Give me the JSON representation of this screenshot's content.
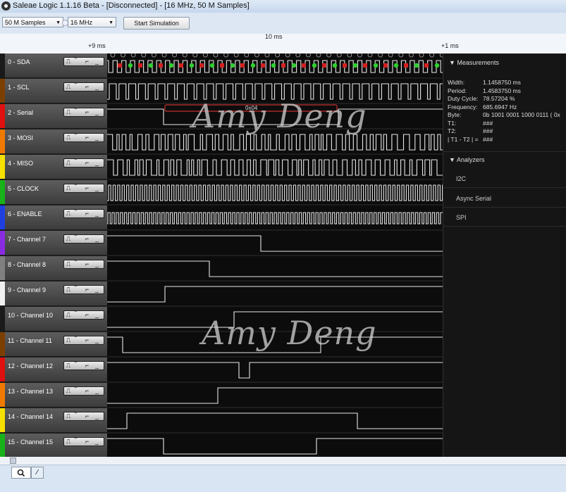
{
  "window": {
    "title": "Saleae Logic 1.1.16 Beta - [Disconnected] - [16 MHz, 50 M Samples]"
  },
  "toolbar": {
    "samples": "50 M Samples",
    "rate": "16 MHz",
    "start_simulation": "Start Simulation"
  },
  "ruler": {
    "left": "+9 ms",
    "center": "10 ms",
    "right": "+1 ms"
  },
  "channels": [
    {
      "name": "0 - SDA",
      "color": "#1a1a1a"
    },
    {
      "name": "1 - SCL",
      "color": "#7b3f00"
    },
    {
      "name": "2 - Serial",
      "color": "#e01010"
    },
    {
      "name": "3 - MOSI",
      "color": "#f07a00"
    },
    {
      "name": "4 - MISO",
      "color": "#f5e000"
    },
    {
      "name": "5 - CLOCK",
      "color": "#19b219"
    },
    {
      "name": "6 - ENABLE",
      "color": "#1f3fe0"
    },
    {
      "name": "7 - Channel 7",
      "color": "#8a2be2"
    },
    {
      "name": "8 - Channel 8",
      "color": "#808080"
    },
    {
      "name": "9 - Channel 9",
      "color": "#f0f0f0"
    },
    {
      "name": "10 - Channel 10",
      "color": "#1a1a1a"
    },
    {
      "name": "11 - Channel 11",
      "color": "#7b3f00"
    },
    {
      "name": "12 - Channel 12",
      "color": "#e01010"
    },
    {
      "name": "13 - Channel 13",
      "color": "#f07a00"
    },
    {
      "name": "14 - Channel 14",
      "color": "#f5e000"
    },
    {
      "name": "15 - Channel 15",
      "color": "#19b219"
    }
  ],
  "serial_label": "0x04",
  "measurements": {
    "header": "Measurements",
    "rows": [
      {
        "label": "Width:",
        "value": "1.1458750 ms"
      },
      {
        "label": "Period:",
        "value": "1.4583750 ms"
      },
      {
        "label": "Duty Cycle:",
        "value": "78.57204 %"
      },
      {
        "label": "Frequency:",
        "value": "685.6947 Hz"
      },
      {
        "label": "Byte:",
        "value": "0b  1001  0001  1000  0111  ( 0x"
      },
      {
        "label": "T1:",
        "value": "###"
      },
      {
        "label": "T2:",
        "value": "###"
      },
      {
        "label": "| T1 - T2 | =",
        "value": "###"
      }
    ]
  },
  "analyzers": {
    "header": "Analyzers",
    "items": [
      "I2C",
      "Async Serial",
      "SPI"
    ]
  },
  "watermark": "Amy Deng",
  "icons": [
    "app-icon",
    "dropdown-caret-icon",
    "trigger-icon",
    "triangle-down-icon",
    "search-icon"
  ]
}
